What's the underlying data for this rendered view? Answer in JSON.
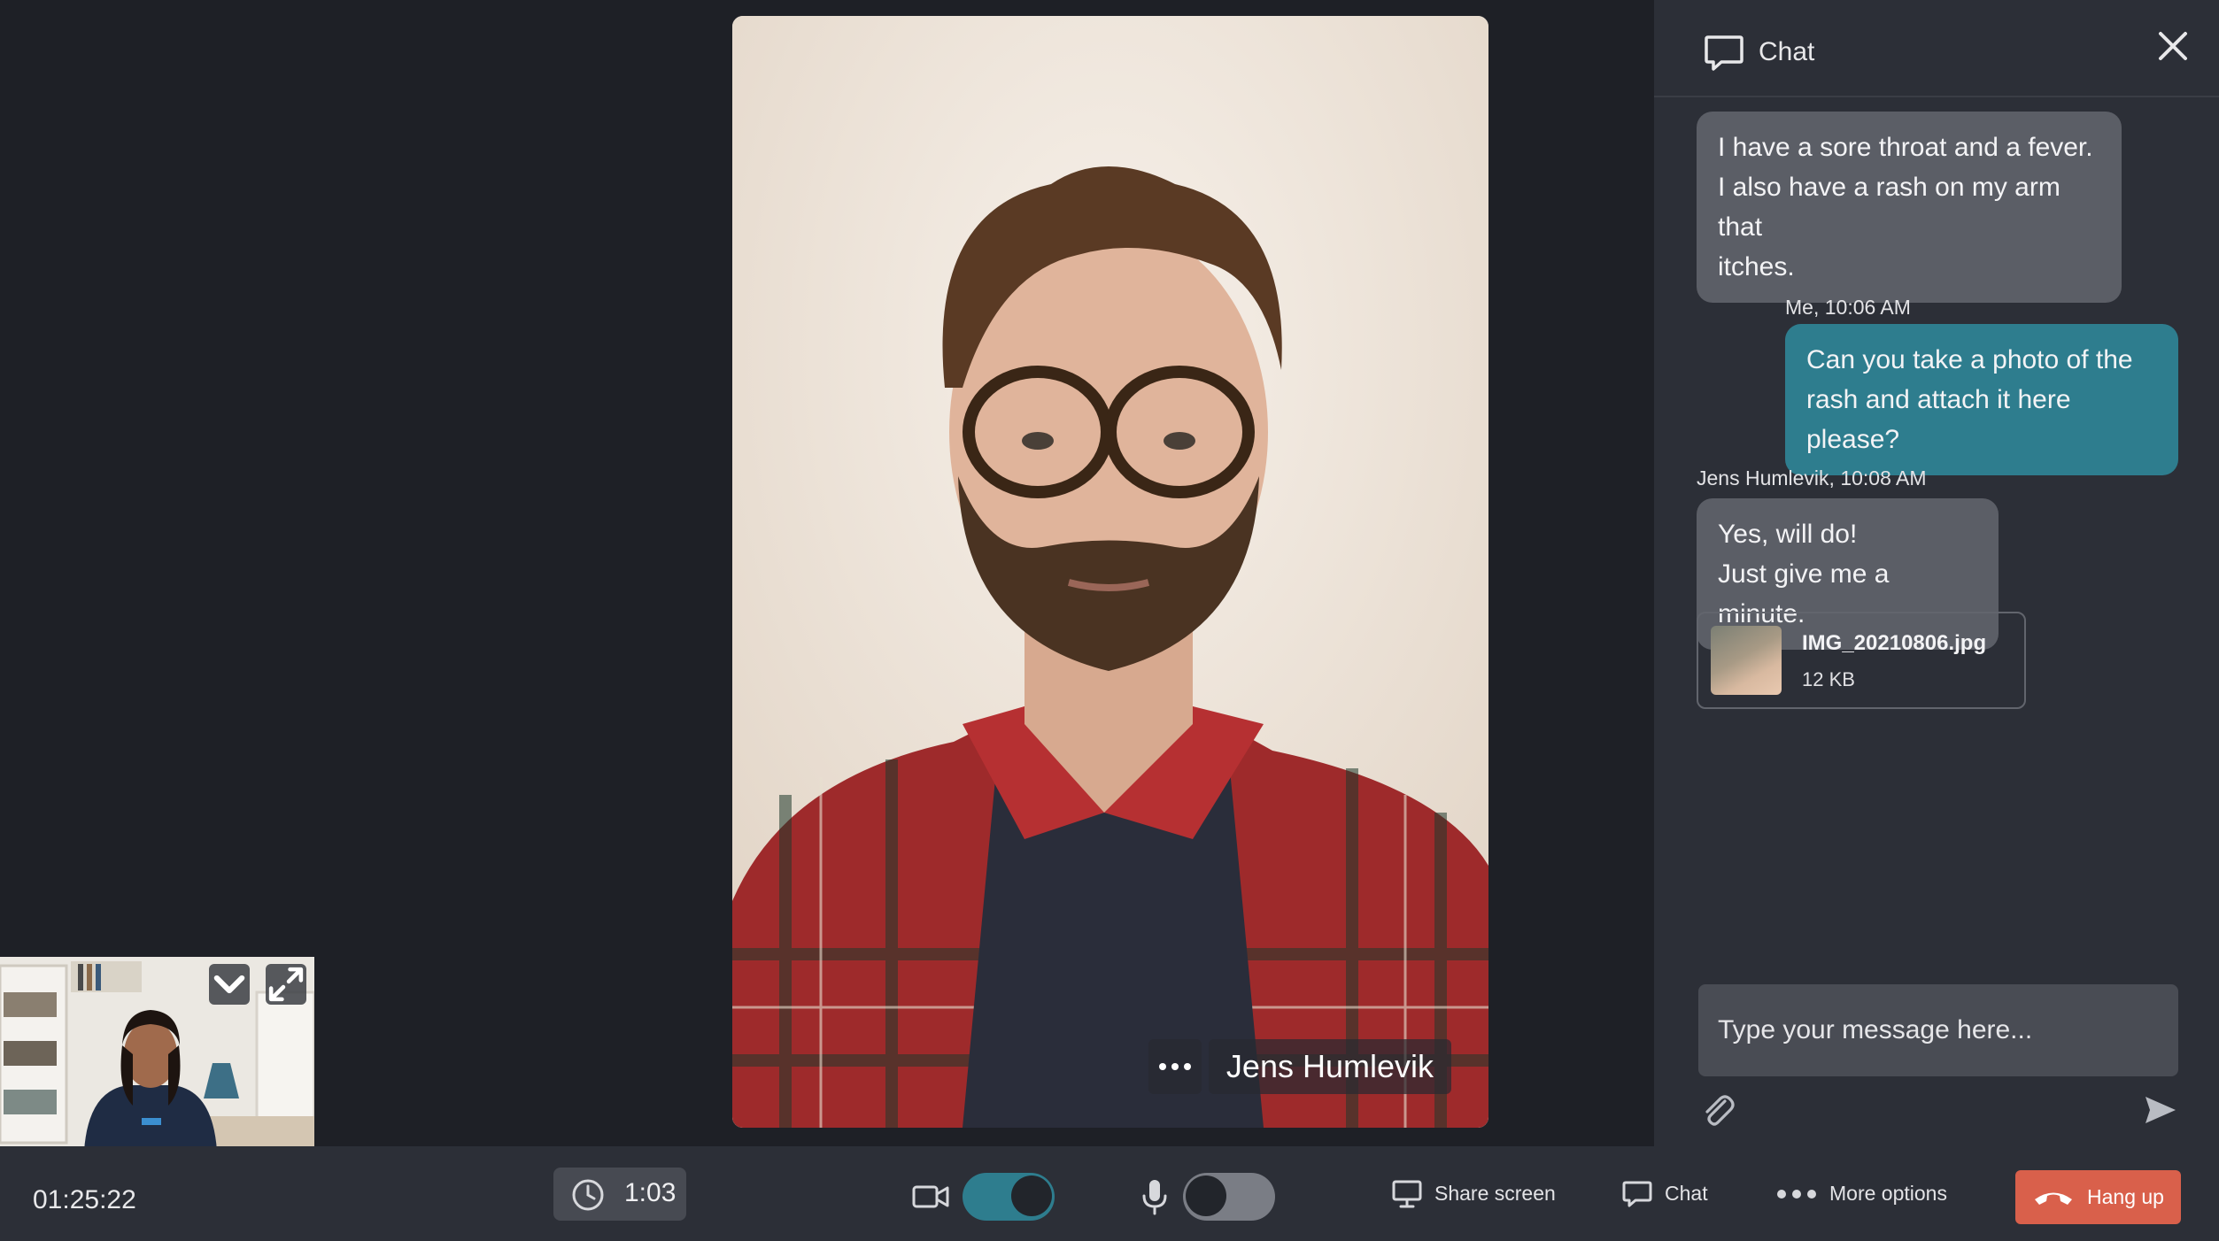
{
  "main_video": {
    "participant_name": "Jens Humlevik"
  },
  "chat": {
    "title": "Chat",
    "messages": [
      {
        "lines": [
          "I have a sore throat and a fever.",
          "I also have a rash on my arm that",
          "itches."
        ]
      },
      {
        "meta": "Me, 10:06 AM",
        "lines": [
          "Can you take a photo of the",
          "rash and attach it here please?"
        ]
      },
      {
        "meta": "Jens Humlevik, 10:08 AM",
        "lines": [
          "Yes, will do!",
          "Just give me a minute."
        ]
      }
    ],
    "attachment": {
      "filename": "IMG_20210806.jpg",
      "size": "12 KB"
    },
    "input_placeholder": "Type your message here..."
  },
  "bottom_bar": {
    "elapsed_time": "01:25:22",
    "timer": "1:03",
    "camera_on": true,
    "microphone_on": false,
    "share_screen_label": "Share screen",
    "chat_label": "Chat",
    "more_options_label": "More options",
    "hang_up_label": "Hang up"
  },
  "colors": {
    "background": "#1e2026",
    "panel": "#2c2f37",
    "incoming_bubble": "#5b5e66",
    "outgoing_bubble": "#2e7d8e",
    "toggle_on": "#2e7d8e",
    "toggle_off": "#7a7d85",
    "hang_up": "#d9604b"
  }
}
